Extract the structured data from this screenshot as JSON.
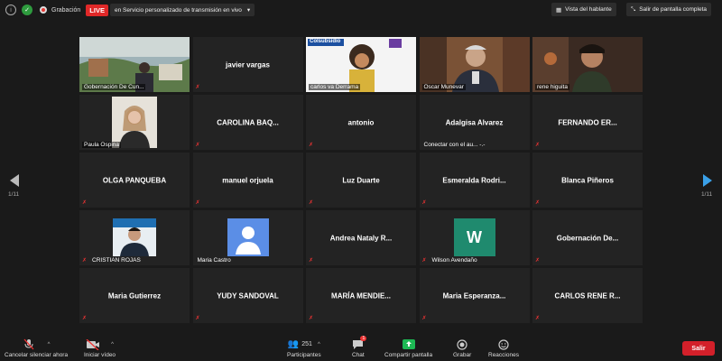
{
  "topbar": {
    "recording_label": "Grabación",
    "live_label": "LIVE",
    "live_dropdown": "en Servicio personalizado de transmisión en vivo",
    "speaker_view": "Vista del hablante",
    "exit_fullscreen": "Salir de pantalla completa"
  },
  "page": {
    "left": "1/11",
    "right": "1/11"
  },
  "tiles": [
    {
      "name": "Gobernación De Cun...",
      "style": "video"
    },
    {
      "name": "javier vargas",
      "style": "center"
    },
    {
      "name": "carlos va Derrama",
      "style": "video"
    },
    {
      "name": "Oscar Munevar",
      "style": "video"
    },
    {
      "name": "rene higuita",
      "style": "video"
    },
    {
      "name": "Paula Ospina",
      "style": "video"
    },
    {
      "name": "CAROLINA BAQ...",
      "style": "center"
    },
    {
      "name": "antonio",
      "style": "center"
    },
    {
      "name": "Adalgisa Alvarez",
      "style": "center",
      "sub": "Conectar con el au... -.-"
    },
    {
      "name": "FERNANDO ER...",
      "style": "center"
    },
    {
      "name": "OLGA PANQUEBA",
      "style": "center"
    },
    {
      "name": "manuel orjuela",
      "style": "center"
    },
    {
      "name": "Luz Duarte",
      "style": "center"
    },
    {
      "name": "Esmeralda  Rodri...",
      "style": "center"
    },
    {
      "name": "Blanca Piñeros",
      "style": "center"
    },
    {
      "name": "CRISTIAN ROJAS",
      "style": "avatar"
    },
    {
      "name": "Maria Castro",
      "style": "avatar"
    },
    {
      "name": "Andrea Nataly R...",
      "style": "center"
    },
    {
      "name": "Wilson Avendaño",
      "style": "letter",
      "letter": "W"
    },
    {
      "name": "Gobernación  De...",
      "style": "center"
    },
    {
      "name": "Maria Gutierrez",
      "style": "center"
    },
    {
      "name": "YUDY SANDOVAL",
      "style": "center"
    },
    {
      "name": "MARÍA  MENDIE...",
      "style": "center"
    },
    {
      "name": "Maria  Esperanza...",
      "style": "center"
    },
    {
      "name": "CARLOS RENE R...",
      "style": "center"
    }
  ],
  "banner": {
    "brand": "Colsubsidio"
  },
  "bottombar": {
    "unmute_all": "Cancelar silenciar ahora",
    "start_video": "Iniciar vídeo",
    "participants_count": "251",
    "participants": "Participantes",
    "chat_badge": "1",
    "chat": "Chat",
    "share_screen": "Compartir pantalla",
    "record": "Grabar",
    "reactions": "Reacciones",
    "exit": "Salir"
  },
  "colors": {
    "live": "#e02828",
    "active_border": "#c8d84a",
    "share": "#1db954",
    "exit": "#d3202a"
  }
}
